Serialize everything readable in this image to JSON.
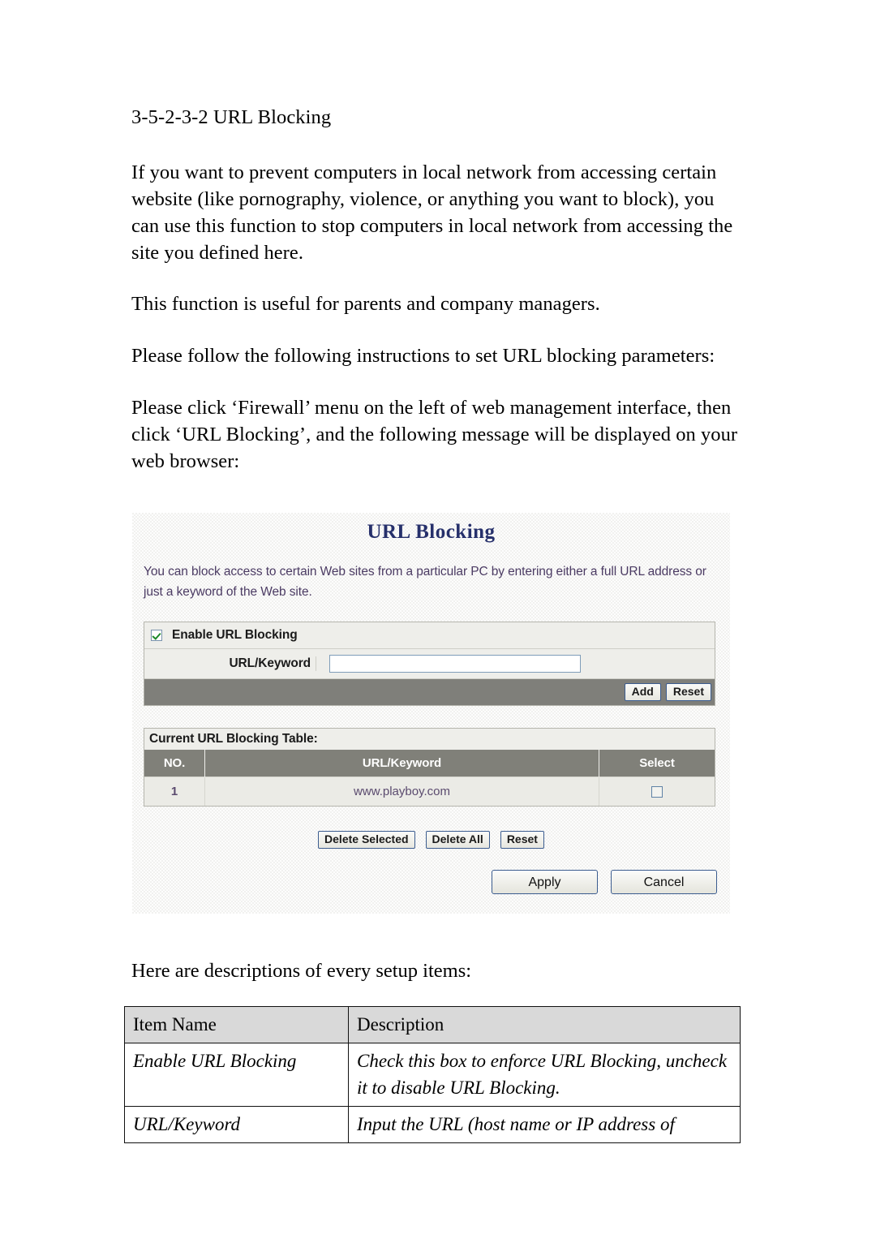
{
  "document": {
    "heading": "3-5-2-3-2 URL Blocking",
    "paragraphs": [
      "If you want to prevent computers in local network from accessing certain website (like pornography, violence, or anything you want to block), you can use this function to stop computers in local network from accessing the site you defined here.",
      "This function is useful for parents and company managers.",
      "Please follow the following instructions to set URL blocking parameters:",
      "Please click ‘Firewall’ menu on the left of web management interface, then click ‘URL Blocking’, and the following message will be displayed on your web browser:"
    ],
    "tail_line": "Here are descriptions of every setup items:"
  },
  "screenshot": {
    "title": "URL Blocking",
    "title_color": "#26306b",
    "description": "You can block access to certain Web sites from a particular PC by entering either a full URL address or just a keyword of the Web site.",
    "enable": {
      "label": "Enable URL Blocking",
      "checked": true
    },
    "keyword_field": {
      "label": "URL/Keyword",
      "value": "",
      "placeholder": ""
    },
    "form_buttons": {
      "add": "Add",
      "reset": "Reset"
    },
    "table": {
      "caption": "Current URL Blocking Table:",
      "headers": [
        "NO.",
        "URL/Keyword",
        "Select"
      ],
      "header_bg": "#808079",
      "rows": [
        {
          "no": "1",
          "url": "www.playboy.com",
          "selected": false
        }
      ]
    },
    "delete_buttons": {
      "delete_selected": "Delete Selected",
      "delete_all": "Delete All",
      "reset": "Reset"
    },
    "apply_buttons": {
      "apply": "Apply",
      "cancel": "Cancel"
    }
  },
  "desc_table": {
    "headers": [
      "Item Name",
      "Description"
    ],
    "rows": [
      {
        "item": "Enable URL Blocking",
        "description": "Check this box to enforce URL Blocking, uncheck it to disable URL Blocking."
      },
      {
        "item": "URL/Keyword",
        "description": "Input the URL (host name or IP address of"
      }
    ]
  }
}
